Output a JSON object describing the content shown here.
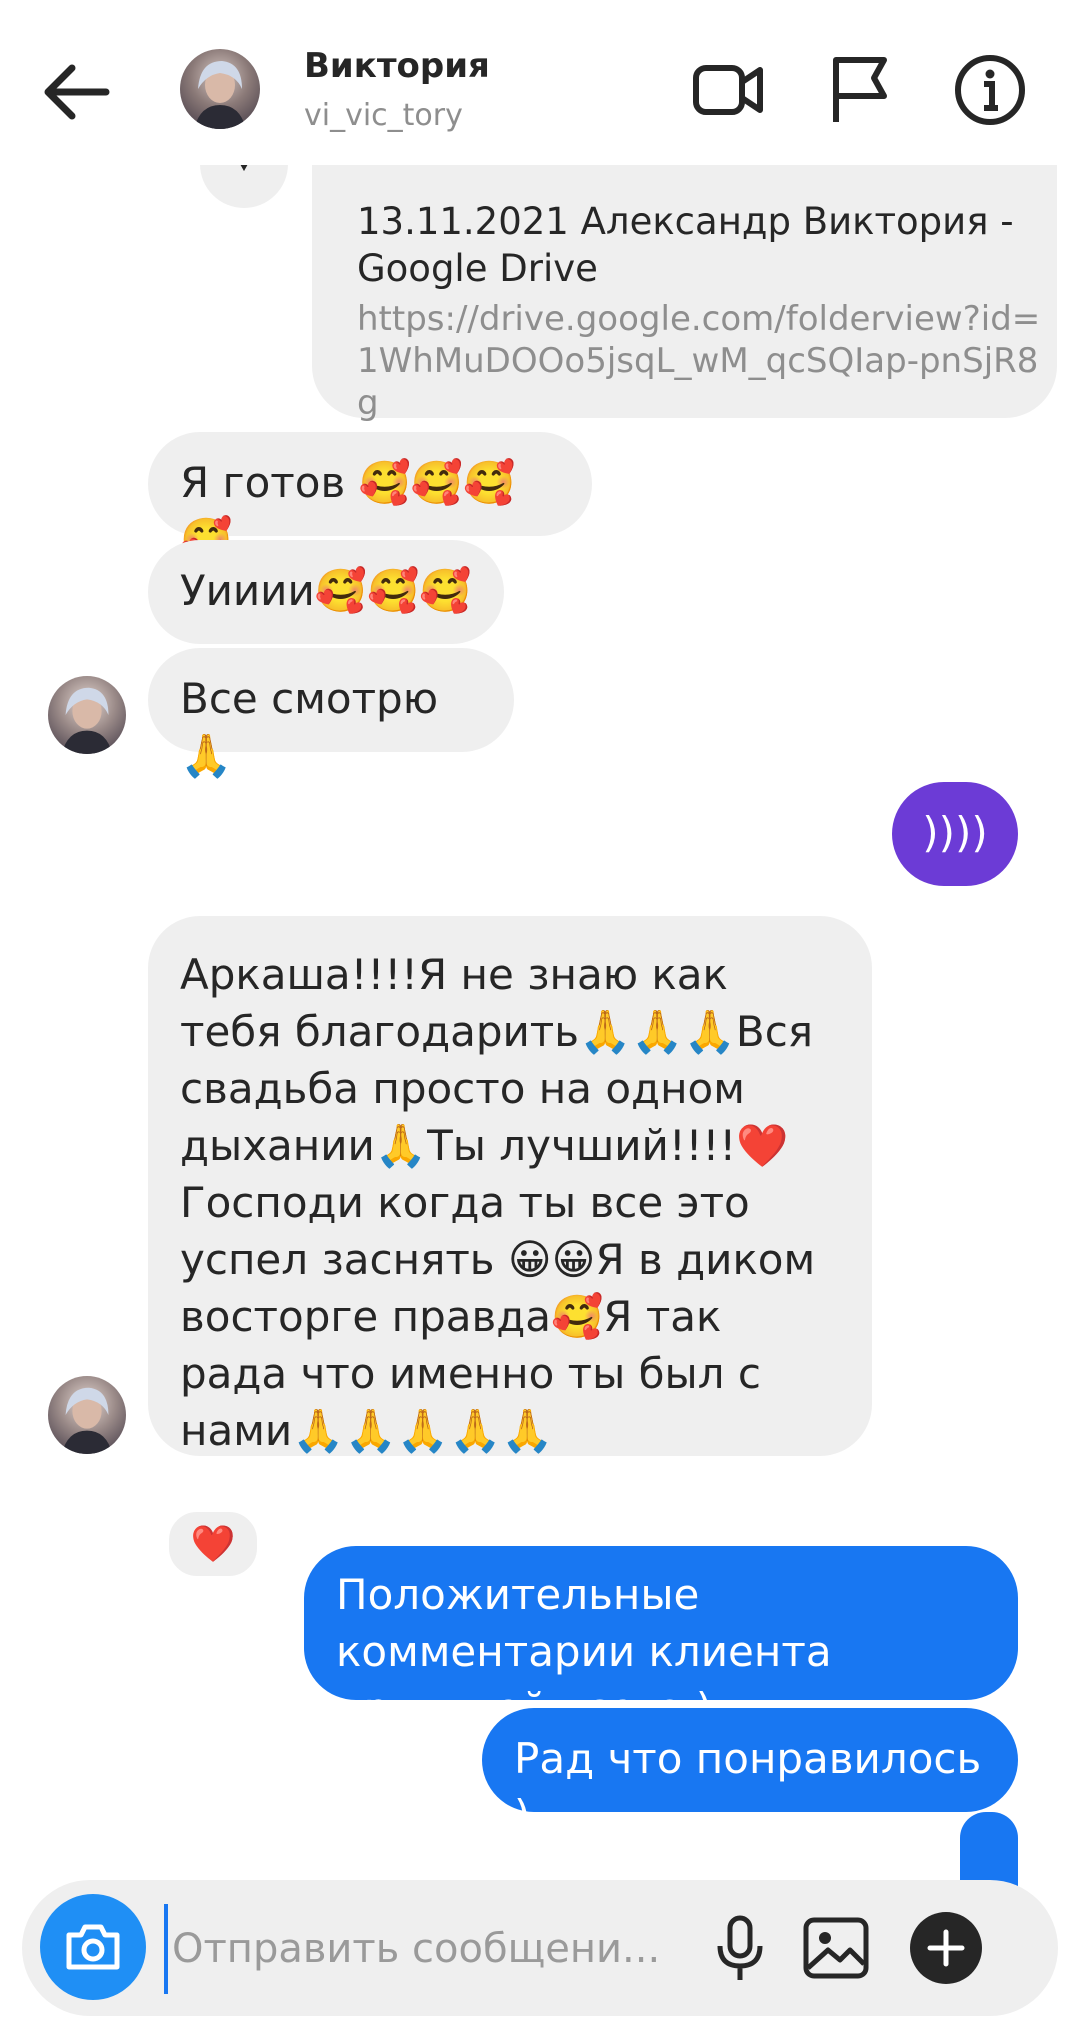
{
  "header": {
    "name": "Виктория",
    "username": "vi_vic_tory"
  },
  "link_card": {
    "title": "13.11.2021 Александр Виктория - Google Drive",
    "url": "https://drive.google.com/folderview?id=1WhMuDOOo5jsqL_wM_qcSQIap-pnSjR8g"
  },
  "messages": [
    {
      "from": "them",
      "text": "Я готов 🥰🥰🥰🥰"
    },
    {
      "from": "them",
      "text": "Уииии🥰🥰🥰"
    },
    {
      "from": "them",
      "text": "Все смотрю🙏"
    },
    {
      "from": "me",
      "text": "))))"
    },
    {
      "from": "them",
      "text": "Аркаша!!!!Я не знаю как тебя благодарить🙏🙏🙏Вся свадьба просто на одном дыхании🙏Ты лучший!!!!❤️ Господи когда ты все это успел заснять 😀😀Я в диком восторге правда🥰Я так рада что именно ты был с нами🙏🙏🙏🙏🙏",
      "reaction": "❤️"
    },
    {
      "from": "me",
      "text": "Положительные комментарии клиента приятней всего )"
    },
    {
      "from": "me",
      "text": "Рад что понравилось )"
    }
  ],
  "composer": {
    "placeholder": "Отправить сообщени..."
  },
  "colors": {
    "outgoing_blue": "#1877f2",
    "outgoing_purple": "#6c3bd6",
    "incoming_gray": "#efefef",
    "camera_button": "#1f8ff5"
  },
  "icons": [
    "back-arrow-icon",
    "video-camera-icon",
    "flag-icon",
    "info-icon",
    "camera-icon",
    "microphone-icon",
    "gallery-icon",
    "plus-icon",
    "chevron-down-icon"
  ]
}
